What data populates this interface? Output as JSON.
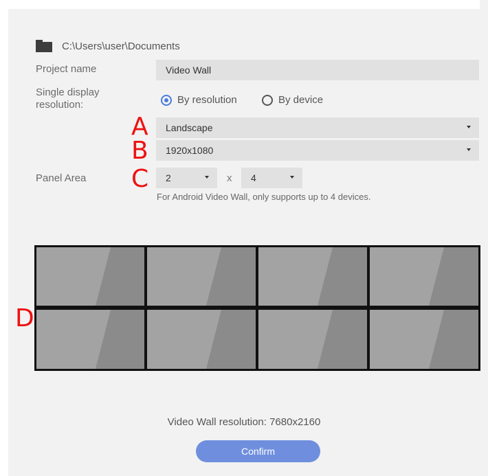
{
  "path": {
    "icon": "folder-icon",
    "text": "C:\\Users\\user\\Documents"
  },
  "project": {
    "label": "Project name",
    "value": "Video Wall"
  },
  "resolution": {
    "label": "Single display resolution:",
    "options": [
      {
        "label": "By resolution",
        "selected": true
      },
      {
        "label": "By device",
        "selected": false
      }
    ],
    "orientation": "Landscape",
    "size": "1920x1080"
  },
  "panel_area": {
    "label": "Panel Area",
    "rows": "2",
    "separator": "x",
    "cols": "4",
    "note": "For Android Video Wall, only supports up to 4 devices."
  },
  "markers": {
    "a": "A",
    "b": "B",
    "c": "C",
    "d": "D"
  },
  "footer": {
    "resolution_text": "Video Wall resolution: 7680x2160",
    "confirm_label": "Confirm"
  },
  "colors": {
    "accent": "#4a7be0",
    "button": "#6f8fde",
    "marker": "#ee1111"
  }
}
